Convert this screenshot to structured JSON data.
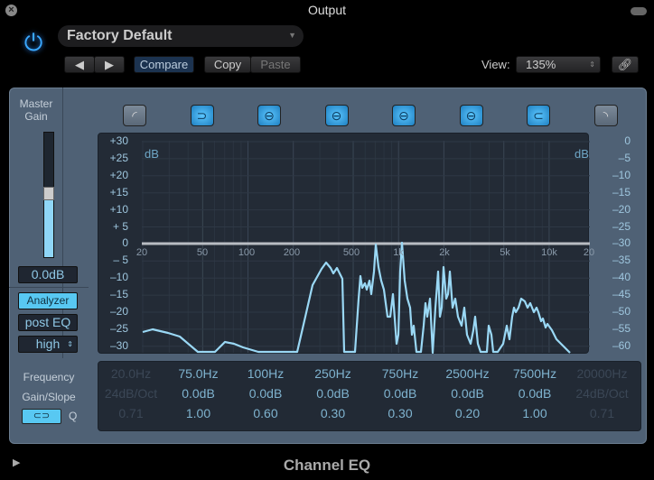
{
  "window": {
    "title": "Output"
  },
  "header": {
    "preset": "Factory Default",
    "compare": "Compare",
    "copy": "Copy",
    "paste": "Paste",
    "view_label": "View:",
    "view_value": "135%"
  },
  "master": {
    "label1": "Master",
    "label2": "Gain",
    "value": "0.0dB",
    "level_fraction": 0.5
  },
  "analyzer": {
    "button": "Analyzer",
    "mode": "post EQ",
    "resolution": "high",
    "active": true
  },
  "graph": {
    "left_unit": "dB",
    "right_unit": "dB",
    "left_ticks": [
      "+30",
      "+25",
      "+20",
      "+15",
      "+10",
      "+ 5",
      "0",
      "– 5",
      "–10",
      "–15",
      "–20",
      "–25",
      "–30"
    ],
    "right_ticks": [
      "0",
      "–5",
      "–10",
      "–15",
      "–20",
      "–25",
      "–30",
      "–35",
      "–40",
      "–45",
      "–50",
      "–55",
      "–60"
    ],
    "freq_ticks": [
      "20",
      "50",
      "100",
      "200",
      "500",
      "1k",
      "2k",
      "5k",
      "10k",
      "20"
    ]
  },
  "bands": [
    {
      "icon": "low-cut-icon",
      "on": false
    },
    {
      "icon": "low-shelf-icon",
      "on": true
    },
    {
      "icon": "peak-icon",
      "on": true
    },
    {
      "icon": "peak-icon",
      "on": true
    },
    {
      "icon": "peak-icon",
      "on": true
    },
    {
      "icon": "peak-icon",
      "on": true
    },
    {
      "icon": "high-shelf-icon",
      "on": true
    },
    {
      "icon": "high-cut-icon",
      "on": false
    }
  ],
  "params": {
    "row_labels": [
      "Frequency",
      "Gain/Slope",
      "Q"
    ],
    "frequency": [
      "20.0Hz",
      "75.0Hz",
      "100Hz",
      "250Hz",
      "750Hz",
      "2500Hz",
      "7500Hz",
      "20000Hz"
    ],
    "gain": [
      "24dB/Oct",
      "0.0dB",
      "0.0dB",
      "0.0dB",
      "0.0dB",
      "0.0dB",
      "0.0dB",
      "24dB/Oct"
    ],
    "q": [
      "0.71",
      "1.00",
      "0.60",
      "0.30",
      "0.30",
      "0.20",
      "1.00",
      "0.71"
    ]
  },
  "footer": {
    "name": "Channel EQ"
  },
  "colors": {
    "accent": "#5bc6ff",
    "trace": "#9ad8f5",
    "panel": "#4f6175"
  }
}
